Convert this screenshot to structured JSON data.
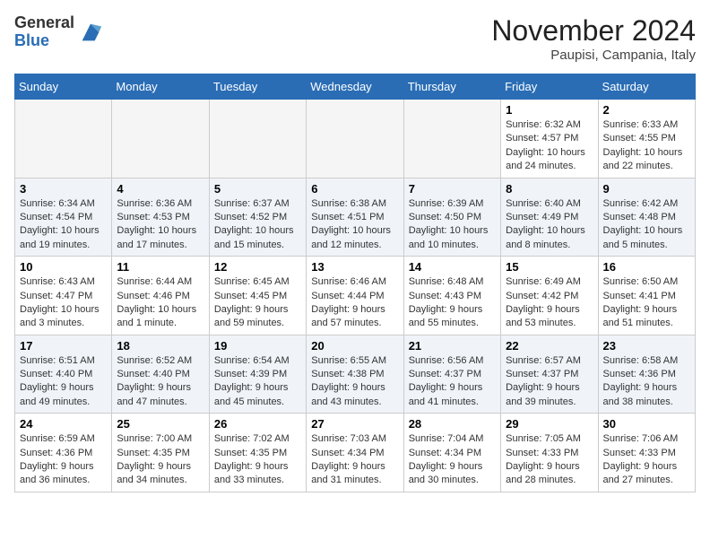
{
  "header": {
    "logo_general": "General",
    "logo_blue": "Blue",
    "month_title": "November 2024",
    "location": "Paupisi, Campania, Italy"
  },
  "weekdays": [
    "Sunday",
    "Monday",
    "Tuesday",
    "Wednesday",
    "Thursday",
    "Friday",
    "Saturday"
  ],
  "days": [
    {
      "date": "",
      "info": ""
    },
    {
      "date": "",
      "info": ""
    },
    {
      "date": "",
      "info": ""
    },
    {
      "date": "",
      "info": ""
    },
    {
      "date": "",
      "info": ""
    },
    {
      "date": "1",
      "info": "Sunrise: 6:32 AM\nSunset: 4:57 PM\nDaylight: 10 hours and 24 minutes."
    },
    {
      "date": "2",
      "info": "Sunrise: 6:33 AM\nSunset: 4:55 PM\nDaylight: 10 hours and 22 minutes."
    },
    {
      "date": "3",
      "info": "Sunrise: 6:34 AM\nSunset: 4:54 PM\nDaylight: 10 hours and 19 minutes."
    },
    {
      "date": "4",
      "info": "Sunrise: 6:36 AM\nSunset: 4:53 PM\nDaylight: 10 hours and 17 minutes."
    },
    {
      "date": "5",
      "info": "Sunrise: 6:37 AM\nSunset: 4:52 PM\nDaylight: 10 hours and 15 minutes."
    },
    {
      "date": "6",
      "info": "Sunrise: 6:38 AM\nSunset: 4:51 PM\nDaylight: 10 hours and 12 minutes."
    },
    {
      "date": "7",
      "info": "Sunrise: 6:39 AM\nSunset: 4:50 PM\nDaylight: 10 hours and 10 minutes."
    },
    {
      "date": "8",
      "info": "Sunrise: 6:40 AM\nSunset: 4:49 PM\nDaylight: 10 hours and 8 minutes."
    },
    {
      "date": "9",
      "info": "Sunrise: 6:42 AM\nSunset: 4:48 PM\nDaylight: 10 hours and 5 minutes."
    },
    {
      "date": "10",
      "info": "Sunrise: 6:43 AM\nSunset: 4:47 PM\nDaylight: 10 hours and 3 minutes."
    },
    {
      "date": "11",
      "info": "Sunrise: 6:44 AM\nSunset: 4:46 PM\nDaylight: 10 hours and 1 minute."
    },
    {
      "date": "12",
      "info": "Sunrise: 6:45 AM\nSunset: 4:45 PM\nDaylight: 9 hours and 59 minutes."
    },
    {
      "date": "13",
      "info": "Sunrise: 6:46 AM\nSunset: 4:44 PM\nDaylight: 9 hours and 57 minutes."
    },
    {
      "date": "14",
      "info": "Sunrise: 6:48 AM\nSunset: 4:43 PM\nDaylight: 9 hours and 55 minutes."
    },
    {
      "date": "15",
      "info": "Sunrise: 6:49 AM\nSunset: 4:42 PM\nDaylight: 9 hours and 53 minutes."
    },
    {
      "date": "16",
      "info": "Sunrise: 6:50 AM\nSunset: 4:41 PM\nDaylight: 9 hours and 51 minutes."
    },
    {
      "date": "17",
      "info": "Sunrise: 6:51 AM\nSunset: 4:40 PM\nDaylight: 9 hours and 49 minutes."
    },
    {
      "date": "18",
      "info": "Sunrise: 6:52 AM\nSunset: 4:40 PM\nDaylight: 9 hours and 47 minutes."
    },
    {
      "date": "19",
      "info": "Sunrise: 6:54 AM\nSunset: 4:39 PM\nDaylight: 9 hours and 45 minutes."
    },
    {
      "date": "20",
      "info": "Sunrise: 6:55 AM\nSunset: 4:38 PM\nDaylight: 9 hours and 43 minutes."
    },
    {
      "date": "21",
      "info": "Sunrise: 6:56 AM\nSunset: 4:37 PM\nDaylight: 9 hours and 41 minutes."
    },
    {
      "date": "22",
      "info": "Sunrise: 6:57 AM\nSunset: 4:37 PM\nDaylight: 9 hours and 39 minutes."
    },
    {
      "date": "23",
      "info": "Sunrise: 6:58 AM\nSunset: 4:36 PM\nDaylight: 9 hours and 38 minutes."
    },
    {
      "date": "24",
      "info": "Sunrise: 6:59 AM\nSunset: 4:36 PM\nDaylight: 9 hours and 36 minutes."
    },
    {
      "date": "25",
      "info": "Sunrise: 7:00 AM\nSunset: 4:35 PM\nDaylight: 9 hours and 34 minutes."
    },
    {
      "date": "26",
      "info": "Sunrise: 7:02 AM\nSunset: 4:35 PM\nDaylight: 9 hours and 33 minutes."
    },
    {
      "date": "27",
      "info": "Sunrise: 7:03 AM\nSunset: 4:34 PM\nDaylight: 9 hours and 31 minutes."
    },
    {
      "date": "28",
      "info": "Sunrise: 7:04 AM\nSunset: 4:34 PM\nDaylight: 9 hours and 30 minutes."
    },
    {
      "date": "29",
      "info": "Sunrise: 7:05 AM\nSunset: 4:33 PM\nDaylight: 9 hours and 28 minutes."
    },
    {
      "date": "30",
      "info": "Sunrise: 7:06 AM\nSunset: 4:33 PM\nDaylight: 9 hours and 27 minutes."
    }
  ]
}
